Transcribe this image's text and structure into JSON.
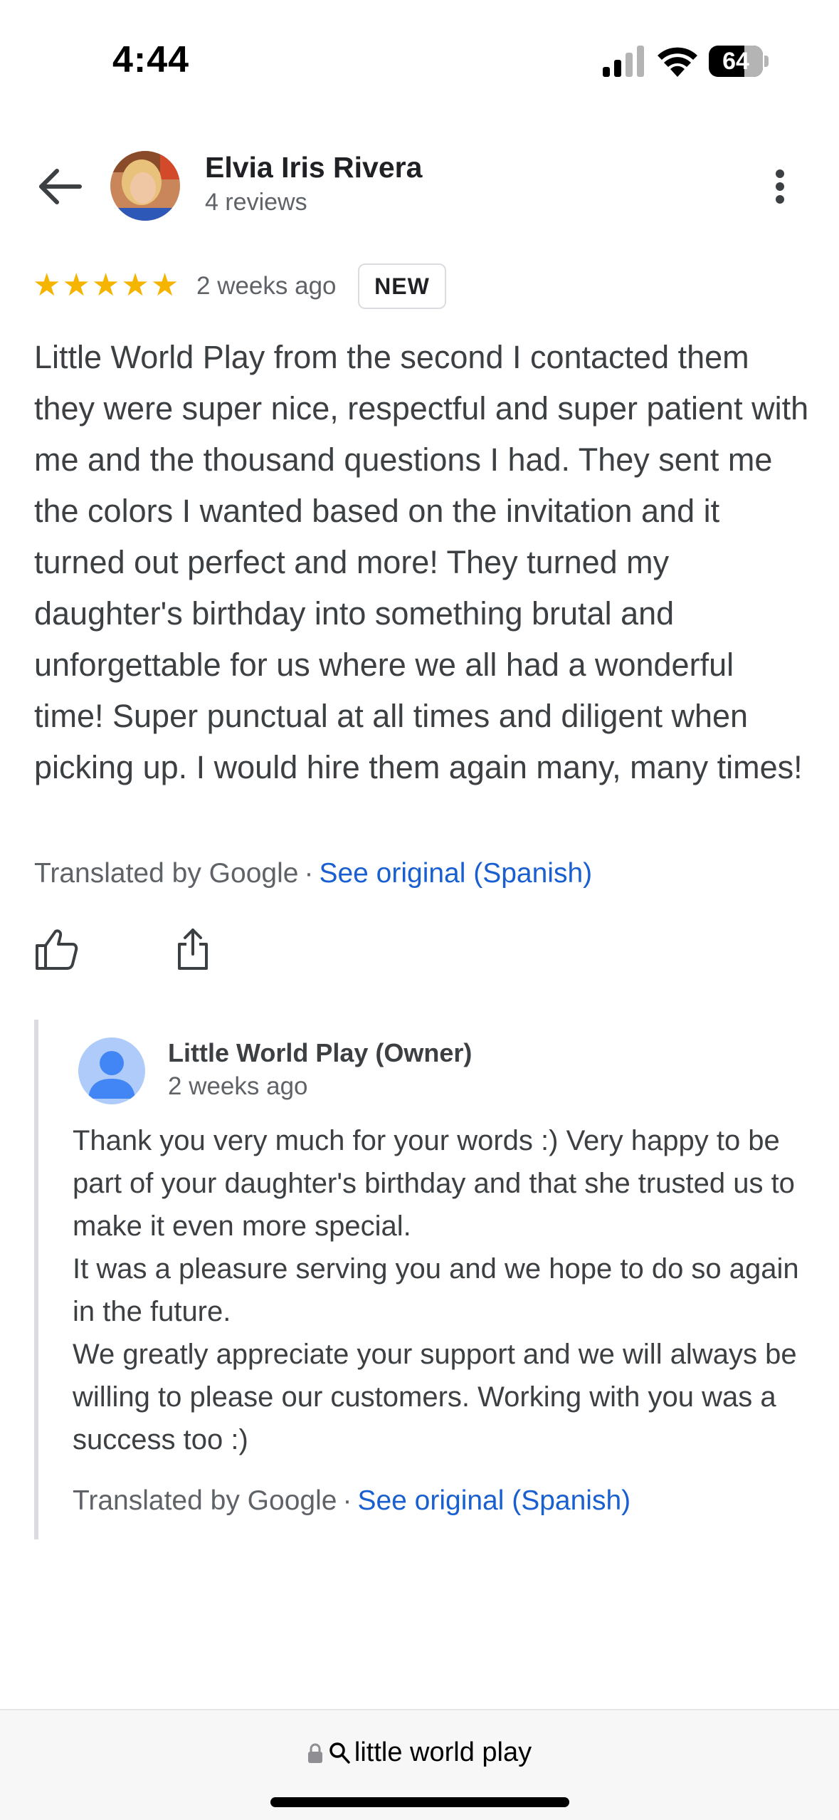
{
  "status_bar": {
    "time": "4:44",
    "battery": "64"
  },
  "reviewer": {
    "name": "Elvia Iris Rivera",
    "reviews_count": "4 reviews"
  },
  "review": {
    "rating": 5,
    "stars": [
      "★",
      "★",
      "★",
      "★",
      "★"
    ],
    "time": "2 weeks ago",
    "badge": "NEW",
    "text": "Little World Play from the second I contacted them they were super nice, respectful and super patient with me and the thousand questions I had. They sent me the colors I wanted based on the invitation and it turned out perfect and more! They turned my daughter's birthday into something brutal and unforgettable for us where we all had a wonderful time! Super punctual at all times and diligent when picking up. I would hire them again many, many times!",
    "translated_label": "Translated by Google",
    "separator": "·",
    "see_original": "See original (Spanish)"
  },
  "owner_reply": {
    "name": "Little World Play (Owner)",
    "time": "2 weeks ago",
    "paragraphs": [
      "Thank you very much for your words :) Very happy to be part of your daughter's birthday and that she trusted us to make it even more special.",
      "It was a pleasure serving you and we hope to do so again in the future.",
      "We greatly appreciate your support and we will always be willing to please our customers. Working with you was a success too :)"
    ],
    "translated_label": "Translated by Google",
    "separator": "·",
    "see_original": "See original (Spanish)"
  },
  "browser": {
    "address": "little world play"
  },
  "colors": {
    "star": "#f4b400",
    "link": "#1a5fd0",
    "reply_border": "#dadce0"
  },
  "icons": {
    "back": "arrow-back-icon",
    "more": "more-vert-icon",
    "like": "thumb-up-icon",
    "share": "share-icon",
    "lock": "lock-icon",
    "search": "search-icon"
  }
}
